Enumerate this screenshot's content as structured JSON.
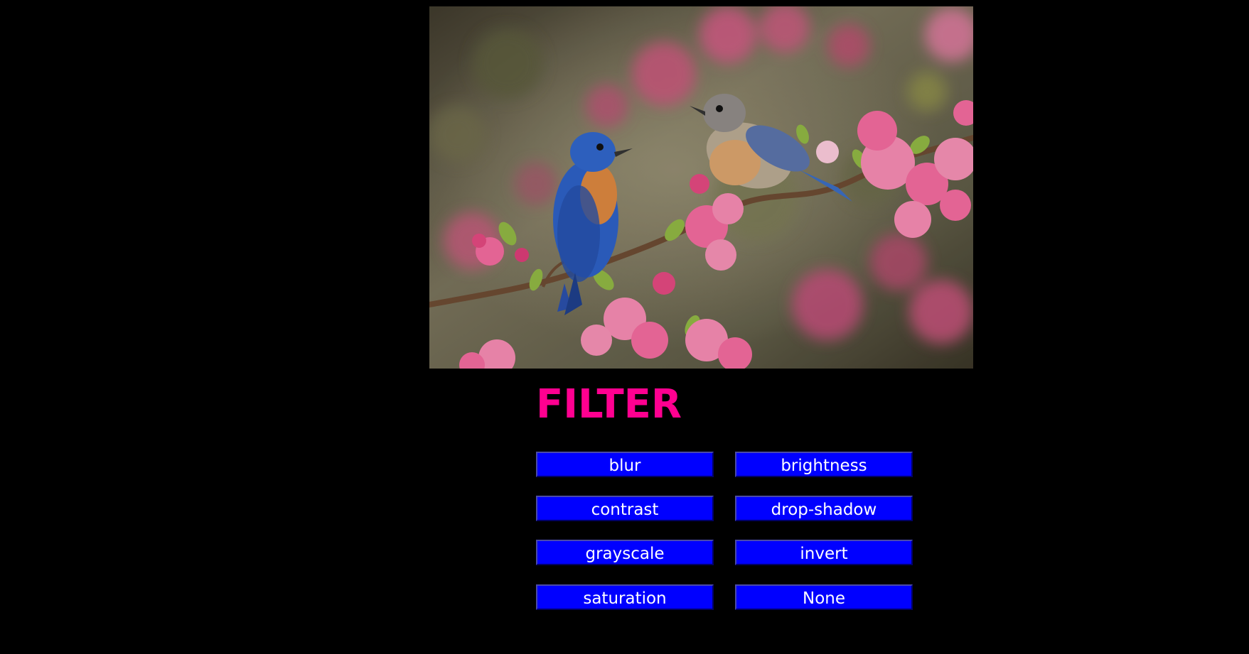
{
  "page": {
    "background": "#000000"
  },
  "image": {
    "description_icon": "birds-on-blossom-branch-photo",
    "palette": {
      "bird_blue": "#2d5fc2",
      "bird_orange": "#d9853f",
      "blossom_pink": "#f06a9c",
      "leaf_green": "#8fb543",
      "background_blur": "#6f6a52"
    }
  },
  "heading": {
    "text": "FILTER",
    "color": "#ff0090"
  },
  "buttons": [
    {
      "label": "blur",
      "name": "blur-filter-button"
    },
    {
      "label": "brightness",
      "name": "brightness-filter-button"
    },
    {
      "label": "contrast",
      "name": "contrast-filter-button"
    },
    {
      "label": "drop-shadow",
      "name": "drop-shadow-filter-button"
    },
    {
      "label": "grayscale",
      "name": "grayscale-filter-button"
    },
    {
      "label": "invert",
      "name": "invert-filter-button"
    },
    {
      "label": "saturation",
      "name": "saturation-filter-button"
    },
    {
      "label": "None",
      "name": "none-filter-button"
    }
  ],
  "button_style": {
    "background": "#0000ff",
    "text_color": "#ffffff"
  }
}
